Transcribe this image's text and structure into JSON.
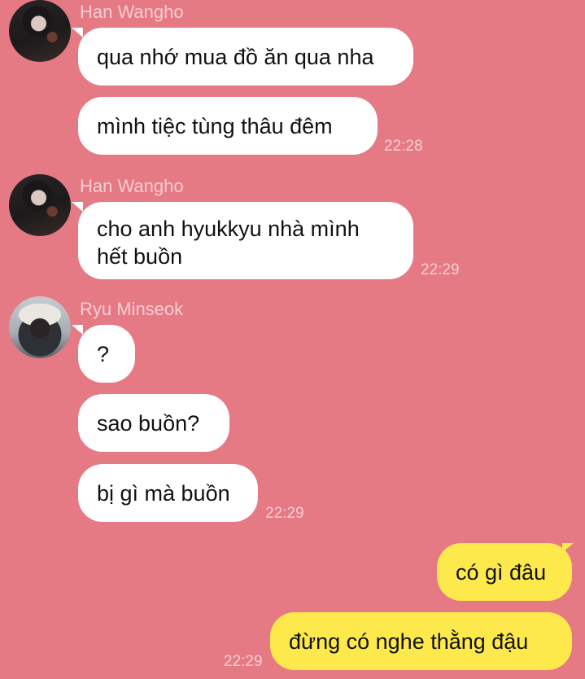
{
  "messages": [
    {
      "sender": "Han Wangho",
      "lines": [
        "qua nhớ mua đồ ăn qua nha",
        "mình tiệc tùng thâu đêm"
      ],
      "time": "22:28"
    },
    {
      "sender": "Han Wangho",
      "lines": [
        "cho anh hyukkyu nhà mình hết buồn"
      ],
      "time": "22:29"
    },
    {
      "sender": "Ryu Minseok",
      "lines": [
        "?",
        "sao buồn?",
        "bị gì mà buồn"
      ],
      "time": "22:29"
    },
    {
      "sender": "me",
      "lines": [
        "có gì đâu",
        "đừng có nghe thằng đậu"
      ],
      "time": "22:29"
    }
  ],
  "colors": {
    "background": "#e57a85",
    "incoming_bubble": "#ffffff",
    "outgoing_bubble": "#fde94c"
  }
}
